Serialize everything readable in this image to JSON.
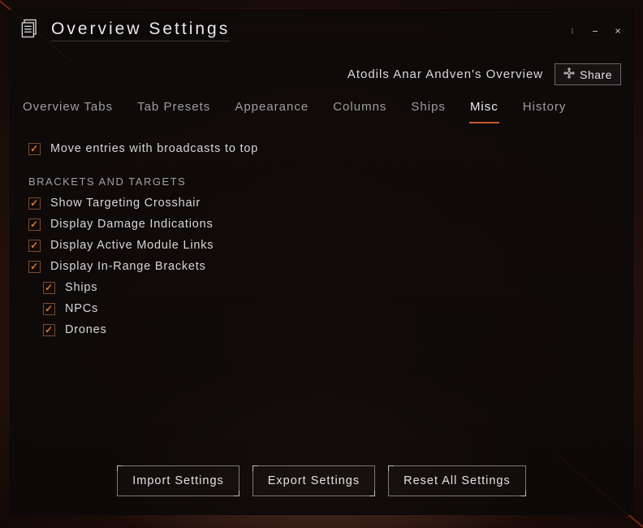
{
  "window": {
    "title": "Overview Settings"
  },
  "subheader": {
    "overview_name": "Atodils Anar Andven's Overview",
    "share_label": "Share"
  },
  "tabs": [
    {
      "label": "Overview Tabs",
      "active": false
    },
    {
      "label": "Tab Presets",
      "active": false
    },
    {
      "label": "Appearance",
      "active": false
    },
    {
      "label": "Columns",
      "active": false
    },
    {
      "label": "Ships",
      "active": false
    },
    {
      "label": "Misc",
      "active": true
    },
    {
      "label": "History",
      "active": false
    }
  ],
  "misc": {
    "move_broadcast": {
      "label": "Move entries with broadcasts to top",
      "checked": true
    },
    "section_title": "BRACKETS AND TARGETS",
    "crosshair": {
      "label": "Show Targeting Crosshair",
      "checked": true
    },
    "damage": {
      "label": "Display Damage Indications",
      "checked": true
    },
    "module_links": {
      "label": "Display Active Module Links",
      "checked": true
    },
    "in_range": {
      "label": "Display In-Range Brackets",
      "checked": true
    },
    "sub_ships": {
      "label": "Ships",
      "checked": true
    },
    "sub_npcs": {
      "label": "NPCs",
      "checked": true
    },
    "sub_drones": {
      "label": "Drones",
      "checked": true
    }
  },
  "footer": {
    "import": "Import Settings",
    "export": "Export Settings",
    "reset": "Reset All Settings"
  }
}
